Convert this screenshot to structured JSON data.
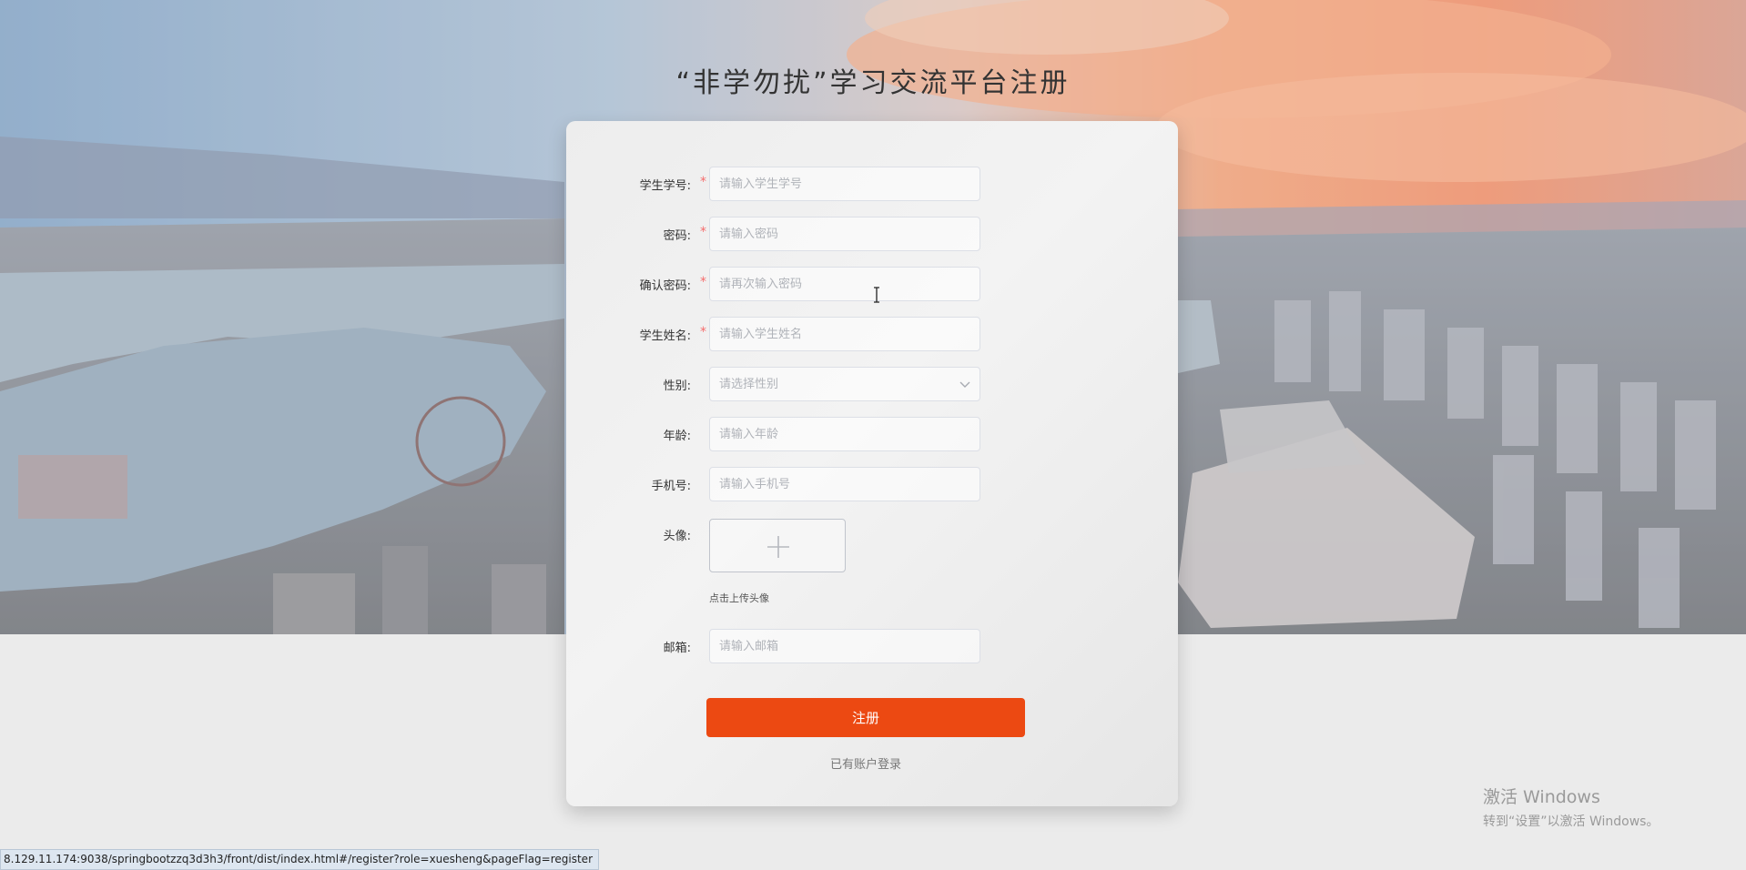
{
  "title": "“非学勿扰”学习交流平台注册",
  "form": {
    "fields": [
      {
        "label": "学生学号:",
        "required": true,
        "placeholder": "请输入学生学号"
      },
      {
        "label": "密码:",
        "required": true,
        "placeholder": "请输入密码"
      },
      {
        "label": "确认密码:",
        "required": true,
        "placeholder": "请再次输入密码"
      },
      {
        "label": "学生姓名:",
        "required": true,
        "placeholder": "请输入学生姓名"
      },
      {
        "label": "性别:",
        "required": false,
        "placeholder": "请选择性别"
      },
      {
        "label": "年龄:",
        "required": false,
        "placeholder": "请输入年龄"
      },
      {
        "label": "手机号:",
        "required": false,
        "placeholder": "请输入手机号"
      }
    ],
    "avatar": {
      "label": "头像:",
      "hint": "点击上传头像"
    },
    "email": {
      "label": "邮箱:",
      "placeholder": "请输入邮箱"
    },
    "required_mark": "*",
    "register_button": "注册",
    "login_link": "已有账户登录"
  },
  "watermark": {
    "line1": "激活 Windows",
    "line2": "转到“设置”以激活 Windows。"
  },
  "status_url": "8.129.11.174:9038/springbootzzq3d3h3/front/dist/index.html#/register?role=xuesheng&pageFlag=register",
  "colors": {
    "accent": "#ec4912",
    "required": "#f56c6c"
  },
  "icons": {
    "select_arrow": "chevron-down-icon",
    "upload": "plus-icon",
    "cursor": "text-cursor-icon"
  }
}
